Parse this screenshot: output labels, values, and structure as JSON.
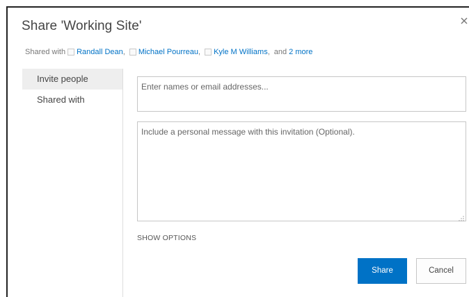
{
  "dialog": {
    "title": "Share 'Working Site'",
    "close_icon": "close-icon"
  },
  "shared_with_row": {
    "label": "Shared with",
    "people": [
      {
        "name": "Randall Dean",
        "separator": ","
      },
      {
        "name": "Michael Pourreau",
        "separator": ","
      },
      {
        "name": "Kyle M Williams",
        "separator": ","
      }
    ],
    "and_text": "and",
    "more_link": "2 more"
  },
  "nav": {
    "items": [
      {
        "label": "Invite people",
        "active": true
      },
      {
        "label": "Shared with",
        "active": false
      }
    ]
  },
  "invite": {
    "placeholder": "Enter names or email addresses...",
    "value": ""
  },
  "message": {
    "placeholder": "Include a personal message with this invitation (Optional).",
    "value": ""
  },
  "show_options_label": "SHOW OPTIONS",
  "buttons": {
    "share_label": "Share",
    "cancel_label": "Cancel"
  },
  "colors": {
    "accent": "#0072c6",
    "link": "#0072c6",
    "nav_active_bg": "#eeeeee",
    "border": "#c6c6c6"
  }
}
